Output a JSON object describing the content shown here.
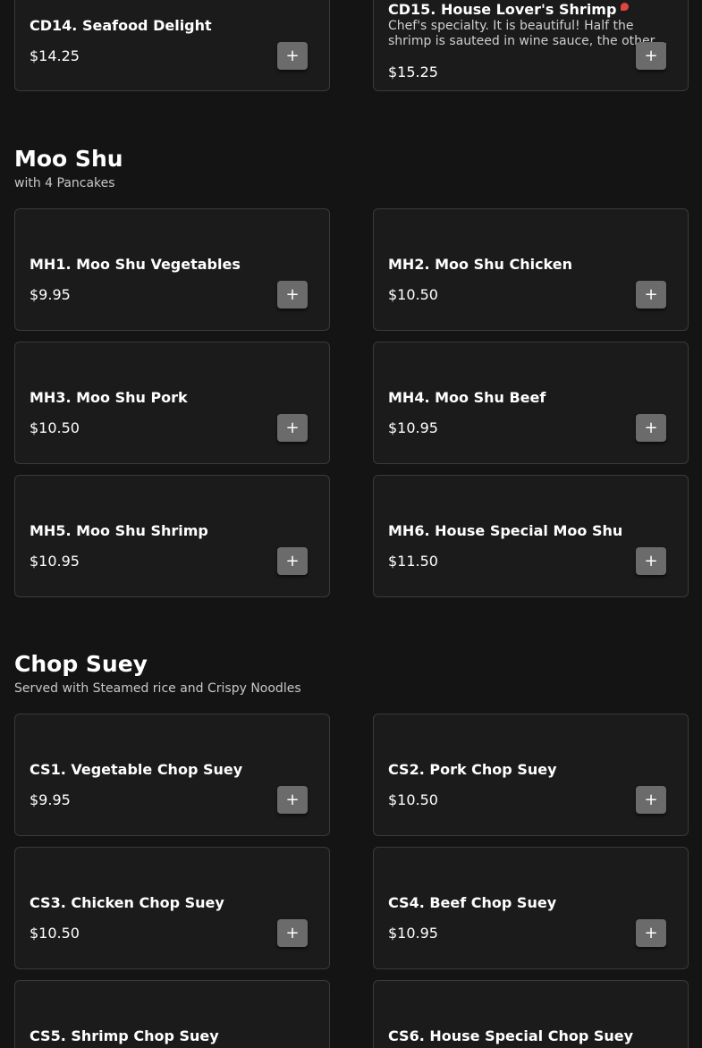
{
  "colors": {
    "background": "#141414",
    "card": "#1b1b1b",
    "border": "#3a3a3a",
    "button": "#6b6b6b"
  },
  "top_items": [
    {
      "name": "CD14. Seafood Delight",
      "price": "$14.25"
    },
    {
      "name": "CD15. House Lover's Shrimp",
      "description": "Chef's specialty. It is beautiful! Half the shrimp is sauteed in wine sauce, the other half is sauteed in spicy sauce.",
      "price": "$15.25",
      "icon": "shrimp-icon"
    }
  ],
  "add_button": {
    "label": "+"
  },
  "moo_shu": {
    "title": "Moo Shu",
    "subtitle": "with 4 Pancakes",
    "items": [
      {
        "name": "MH1. Moo Shu Vegetables",
        "price": "$9.95"
      },
      {
        "name": "MH2. Moo Shu Chicken",
        "price": "$10.50"
      },
      {
        "name": "MH3. Moo Shu Pork",
        "price": "$10.50"
      },
      {
        "name": "MH4. Moo Shu Beef",
        "price": "$10.95"
      },
      {
        "name": "MH5. Moo Shu Shrimp",
        "price": "$10.95"
      },
      {
        "name": "MH6. House Special Moo Shu",
        "price": "$11.50"
      }
    ]
  },
  "chop_suey": {
    "title": "Chop Suey",
    "subtitle": "Served with Steamed rice and Crispy Noodles",
    "items": [
      {
        "name": "CS1. Vegetable Chop Suey",
        "price": "$9.95"
      },
      {
        "name": "CS2. Pork Chop Suey",
        "price": "$10.50"
      },
      {
        "name": "CS3. Chicken Chop Suey",
        "price": "$10.50"
      },
      {
        "name": "CS4. Beef Chop Suey",
        "price": "$10.95"
      },
      {
        "name": "CS5. Shrimp Chop Suey"
      },
      {
        "name": "CS6. House Special Chop Suey"
      }
    ]
  }
}
